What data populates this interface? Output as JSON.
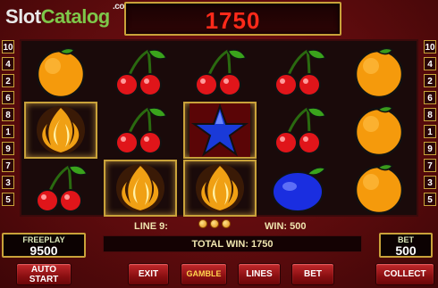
{
  "logo": {
    "slot": "Slot",
    "catalog": "Catalog",
    "com": ".com"
  },
  "win_display": {
    "value": "1750"
  },
  "lines_left": [
    "10",
    "4",
    "2",
    "6",
    "8",
    "1",
    "9",
    "7",
    "3",
    "5"
  ],
  "lines_right": [
    "10",
    "4",
    "2",
    "6",
    "8",
    "1",
    "9",
    "7",
    "3",
    "5"
  ],
  "reels": [
    [
      "orange",
      "fire",
      "cherry"
    ],
    [
      "cherry",
      "cherry",
      "fire"
    ],
    [
      "cherry",
      "star",
      "fire"
    ],
    [
      "cherry",
      "cherry",
      "plum"
    ],
    [
      "orange",
      "orange",
      "orange"
    ]
  ],
  "info": {
    "line_label": "LINE 9:",
    "win_label": "WIN: 500"
  },
  "total_win": "TOTAL WIN: 1750",
  "freeplay": {
    "label": "FREEPLAY",
    "value": "9500"
  },
  "bet_panel": {
    "label": "BET",
    "value": "500"
  },
  "buttons": {
    "auto_line1": "AUTO",
    "auto_line2": "START",
    "exit": "EXIT",
    "gamble": "GAMBLE",
    "lines": "LINES",
    "bet": "BET",
    "collect": "COLLECT"
  },
  "colors": {
    "accent_gold": "#c9a23a",
    "win_red": "#ff2a1a",
    "background": "#5c0b0d"
  }
}
